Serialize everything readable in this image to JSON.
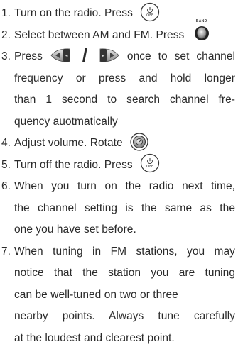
{
  "steps": [
    {
      "num": "1.",
      "text": "Turn on the radio.  Press",
      "icon": "power-button-icon"
    },
    {
      "num": "2.",
      "text": "Select between AM and FM.  Press",
      "icon": "band-button-icon",
      "icon_label": "BAND"
    },
    {
      "num": "3.",
      "text_before": "Press",
      "icon_left": "tune-down-button-icon",
      "separator": "/",
      "icon_right": "tune-up-button-icon",
      "text_after": "once to set channel",
      "lines": [
        "frequency or press and hold longer",
        "than 1 second to search channel fre-",
        "quency auotmatically"
      ]
    },
    {
      "num": "4.",
      "text": "Adjust volume.  Rotate",
      "icon": "volume-knob-icon"
    },
    {
      "num": "5.",
      "text": "Turn off the radio.  Press",
      "icon": "power-button-icon"
    },
    {
      "num": "6.",
      "lines": [
        "When you turn on the radio next time,",
        "the channel setting is the same as the",
        "one you have set before."
      ]
    },
    {
      "num": "7.",
      "lines": [
        "When tuning in FM stations, you may",
        "notice that the station you are tuning",
        "can be well-tuned on two or three",
        "nearby points.  Always tune carefully",
        "at the loudest and clearest point."
      ]
    }
  ]
}
